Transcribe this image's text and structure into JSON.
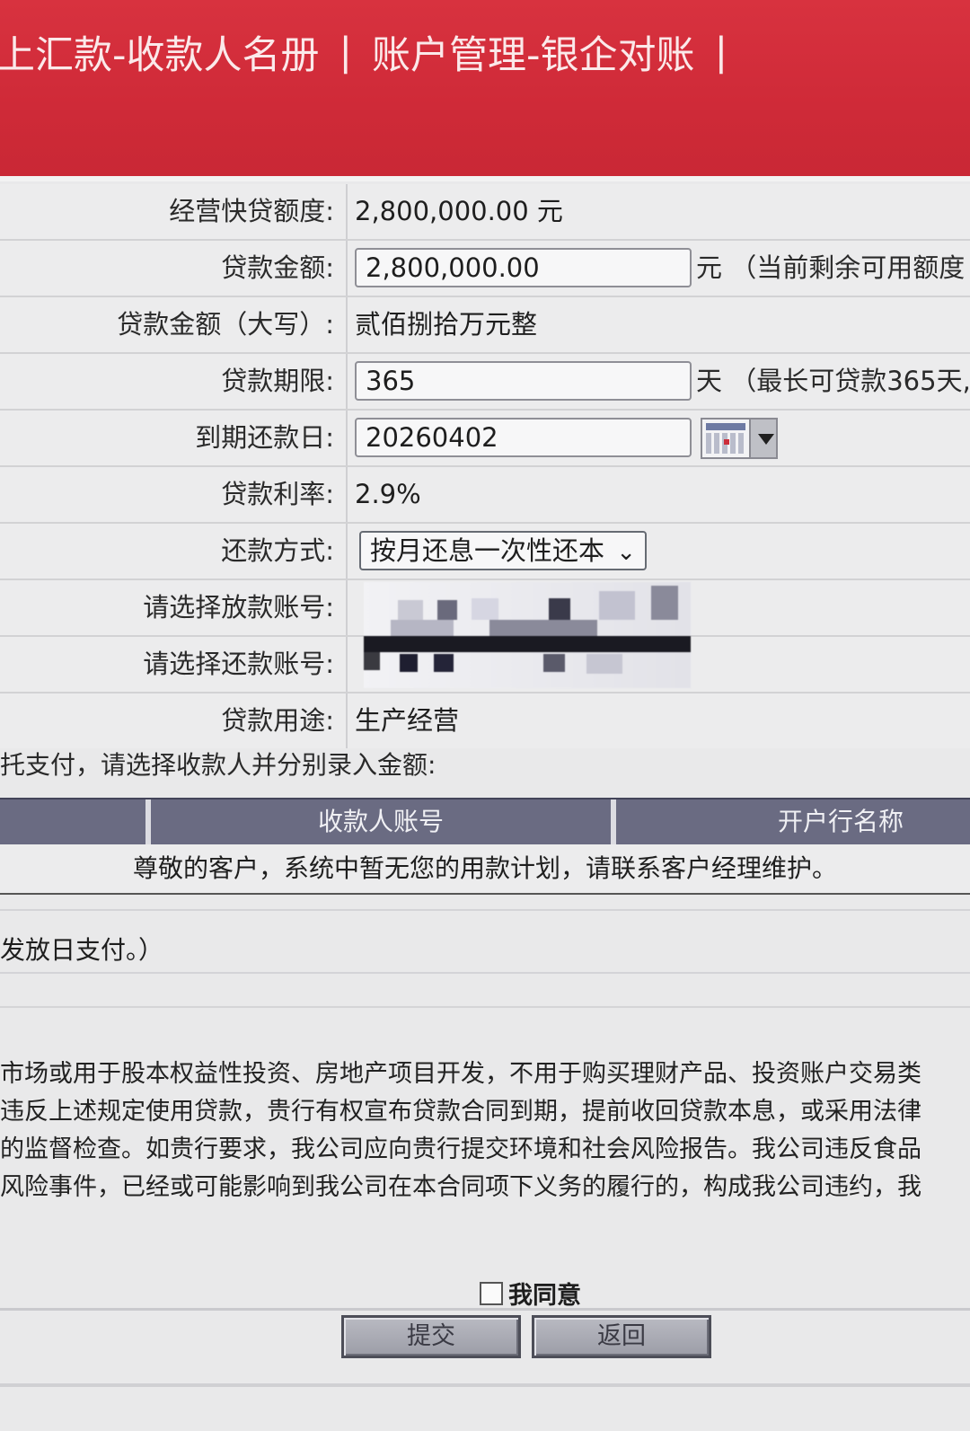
{
  "topnav": {
    "item1": "上汇款-收款人名册",
    "sep": "|",
    "item2": "账户管理-银企对账"
  },
  "form": {
    "quota_label": "经营快贷额度:",
    "quota_value": "2,800,000.00 元",
    "amount_label": "贷款金额:",
    "amount_value": "2,800,000.00",
    "amount_suffix": "元 （当前剩余可用额度",
    "amount_caps_label": "贷款金额（大写）:",
    "amount_caps_value": "贰佰捌拾万元整",
    "term_label": "贷款期限:",
    "term_value": "365",
    "term_suffix": "天 （最长可贷款365天,",
    "due_label": "到期还款日:",
    "due_value": "20260402",
    "rate_label": "贷款利率:",
    "rate_value": "2.9%",
    "repay_label": "还款方式:",
    "repay_value": "按月还息一次性还本",
    "disburse_acct_label": "请选择放款账号:",
    "repay_acct_label": "请选择还款账号:",
    "purpose_label": "贷款用途:",
    "purpose_value": "生产经营"
  },
  "payee": {
    "note": "托支付，请选择收款人并分别录入金额:",
    "col_account": "收款人账号",
    "col_bank": "开户行名称",
    "empty_message": "尊敬的客户，系统中暂无您的用款计划，请联系客户经理维护。",
    "pay_note": "发放日支付。）"
  },
  "terms": {
    "line1": "市场或用于股本权益性投资、房地产项目开发，不用于购买理财产品、投资账户交易类",
    "line2": "违反上述规定使用贷款，贵行有权宣布贷款合同到期，提前收回贷款本息，或采用法律",
    "line3": "的监督检查。如贵行要求，我公司应向贵行提交环境和社会风险报告。我公司违反食品",
    "line4": "风险事件，已经或可能影响到我公司在本合同项下义务的履行的，构成我公司违约，我"
  },
  "agree_label": "我同意",
  "buttons": {
    "submit": "提交",
    "back": "返回"
  },
  "colors": {
    "header_red": "#cf2a38",
    "table_header": "#6a6b82"
  }
}
